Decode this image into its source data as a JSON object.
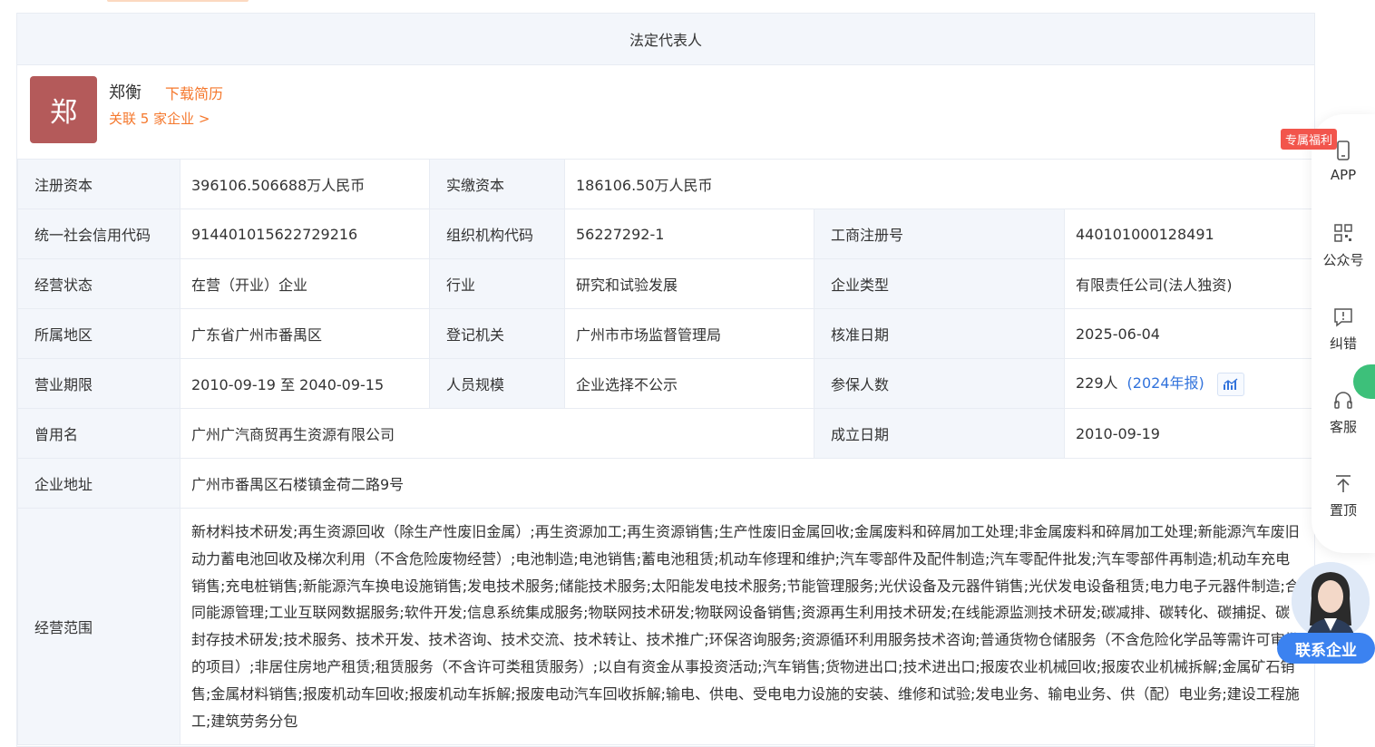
{
  "section_title": "法定代表人",
  "legal_rep": {
    "avatar_char": "郑",
    "name": "郑衡",
    "download_label": "下载简历",
    "related_label": "关联 5 家企业 >"
  },
  "info": {
    "reg_capital_label": "注册资本",
    "reg_capital": "396106.506688万人民币",
    "paid_capital_label": "实缴资本",
    "paid_capital": "186106.50万人民币",
    "credit_code_label": "统一社会信用代码",
    "credit_code": "914401015622729216",
    "org_code_label": "组织机构代码",
    "org_code": "56227292-1",
    "biz_reg_no_label": "工商注册号",
    "biz_reg_no": "440101000128491",
    "status_label": "经营状态",
    "status": "在营（开业）企业",
    "industry_label": "行业",
    "industry": "研究和试验发展",
    "company_type_label": "企业类型",
    "company_type": "有限责任公司(法人独资)",
    "region_label": "所属地区",
    "region": "广东省广州市番禺区",
    "authority_label": "登记机关",
    "authority": "广州市市场监督管理局",
    "approve_date_label": "核准日期",
    "approve_date": "2025-06-04",
    "term_label": "营业期限",
    "term": "2010-09-19 至 2040-09-15",
    "staff_size_label": "人员规模",
    "staff_size": "企业选择不公示",
    "insured_label": "参保人数",
    "insured": "229人",
    "insured_report": "(2024年报)",
    "former_name_label": "曾用名",
    "former_name": "广州广汽商贸再生资源有限公司",
    "found_date_label": "成立日期",
    "found_date": "2010-09-19",
    "address_label": "企业地址",
    "address": "广州市番禺区石楼镇金荷二路9号",
    "scope_label": "经营范围",
    "scope": "新材料技术研发;再生资源回收（除生产性废旧金属）;再生资源加工;再生资源销售;生产性废旧金属回收;金属废料和碎屑加工处理;非金属废料和碎屑加工处理;新能源汽车废旧动力蓄电池回收及梯次利用（不含危险废物经营）;电池制造;电池销售;蓄电池租赁;机动车修理和维护;汽车零部件及配件制造;汽车零配件批发;汽车零部件再制造;机动车充电销售;充电桩销售;新能源汽车换电设施销售;发电技术服务;储能技术服务;太阳能发电技术服务;节能管理服务;光伏设备及元器件销售;光伏发电设备租赁;电力电子元器件制造;合同能源管理;工业互联网数据服务;软件开发;信息系统集成服务;物联网技术研发;物联网设备销售;资源再生利用技术研发;在线能源监测技术研发;碳减排、碳转化、碳捕捉、碳封存技术研发;技术服务、技术开发、技术咨询、技术交流、技术转让、技术推广;环保咨询服务;资源循环利用服务技术咨询;普通货物仓储服务（不含危险化学品等需许可审批的项目）;非居住房地产租赁;租赁服务（不含许可类租赁服务）;以自有资金从事投资活动;汽车销售;货物进出口;技术进出口;报废农业机械回收;报废农业机械拆解;金属矿石销售;金属材料销售;报废机动车回收;报废机动车拆解;报废电动汽车回收拆解;输电、供电、受电电力设施的安装、维修和试验;发电业务、输电业务、供（配）电业务;建设工程施工;建筑劳务分包"
  },
  "float_bar": {
    "badge": "专属福利",
    "app": "APP",
    "wechat": "公众号",
    "report": "纠错",
    "service": "客服",
    "top": "置顶",
    "contact": "联系企业"
  },
  "colors": {
    "accent": "#f5782d",
    "link": "#3273dc",
    "label_bg": "#f3f6fb",
    "avatar_bg": "#b45a5a"
  }
}
